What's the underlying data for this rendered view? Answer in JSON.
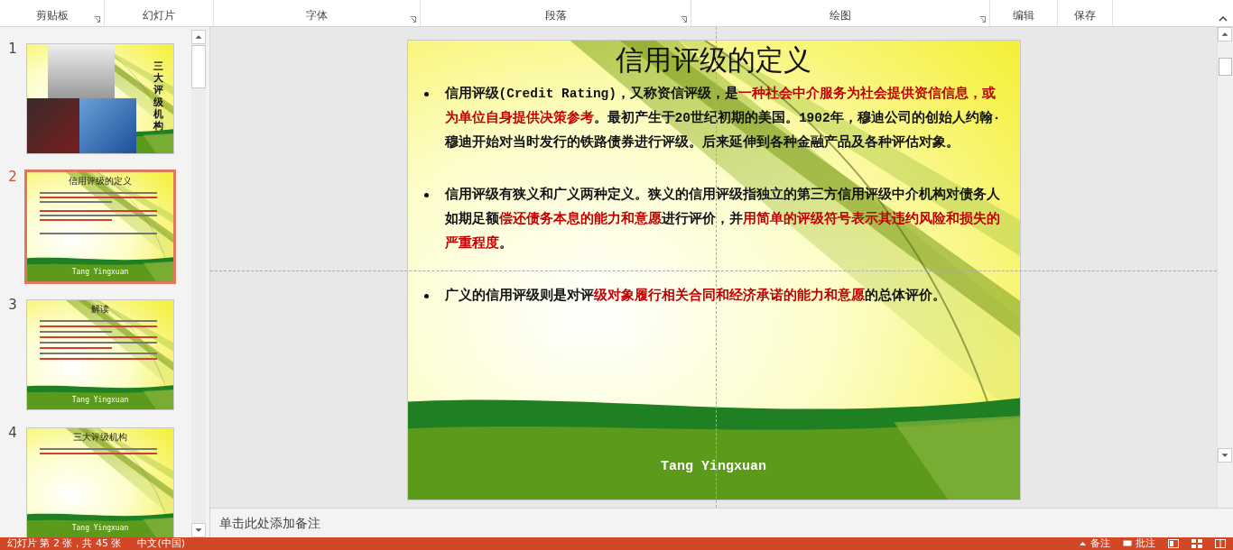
{
  "ribbon": {
    "groups": [
      {
        "label": "剪贴板",
        "launcher": true
      },
      {
        "label": "幻灯片",
        "launcher": false
      },
      {
        "label": "字体",
        "launcher": true
      },
      {
        "label": "段落",
        "launcher": true
      },
      {
        "label": "绘图",
        "launcher": true
      },
      {
        "label": "编辑",
        "launcher": false
      },
      {
        "label": "保存",
        "launcher": false
      }
    ]
  },
  "thumbnails": [
    {
      "number": "1",
      "selected": false,
      "kind": "photos",
      "vertical_title": "三大评级机构"
    },
    {
      "number": "2",
      "selected": true,
      "kind": "text",
      "title": "信用评级的定义",
      "footer": "Tang Yingxuan"
    },
    {
      "number": "3",
      "selected": false,
      "kind": "text",
      "title": "解读",
      "footer": "Tang Yingxuan"
    },
    {
      "number": "4",
      "selected": false,
      "kind": "text",
      "title": "三大评级机构",
      "footer": "Tang Yingxuan"
    }
  ],
  "slide": {
    "title": "信用评级的定义",
    "bullets": [
      {
        "segments": [
          {
            "text": "信用评级(Credit Rating)，又称资信评级，是",
            "emphasis": false
          },
          {
            "text": "一种社会中介服务为社会提供资信信息，或为单位自身提供决策参考",
            "emphasis": true
          },
          {
            "text": "。最初产生于20世纪初期的美国。1902年，穆迪公司的创始人约翰·穆迪开始对当时发行的铁路债券进行评级。后来延伸到各种金融产品及各种评估对象。",
            "emphasis": false
          }
        ]
      },
      {
        "segments": [
          {
            "text": "信用评级有狭义和广义两种定义。狭义的信用评级指独立的第三方信用评级中介机构对债务人如期足额",
            "emphasis": false
          },
          {
            "text": "偿还债务本息的能力和意愿",
            "emphasis": true
          },
          {
            "text": "进行评价，并",
            "emphasis": false
          },
          {
            "text": "用简单的评级符号表示其违约风险和损失的严重程度",
            "emphasis": true
          },
          {
            "text": "。",
            "emphasis": false
          }
        ]
      },
      {
        "segments": [
          {
            "text": "广义的信用评级则是对评",
            "emphasis": false
          },
          {
            "text": "级对象履行相关合同和经济承诺的能力和意愿",
            "emphasis": true
          },
          {
            "text": "的总体评价。",
            "emphasis": false
          }
        ]
      }
    ],
    "footer": "Tang Yingxuan"
  },
  "notes": {
    "placeholder": "单击此处添加备注"
  },
  "status_bar": {
    "slide_info": "幻灯片 第 2 张，共 45 张",
    "language": "中文(中国)",
    "notes": "备注",
    "comments": "批注"
  }
}
